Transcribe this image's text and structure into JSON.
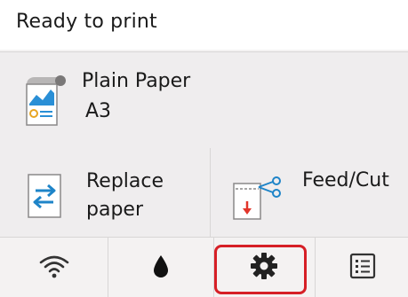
{
  "status": {
    "text": "Ready to print"
  },
  "paper": {
    "type": "Plain Paper",
    "size": "A3",
    "icon": "plain-paper-icon"
  },
  "actions": {
    "replace": {
      "line1": "Replace",
      "line2": "paper",
      "icon": "replace-paper-icon"
    },
    "feed": {
      "label": "Feed/Cut",
      "icon": "feed-cut-icon"
    }
  },
  "bottom_nav": {
    "items": [
      {
        "name": "wifi",
        "icon": "wifi-icon"
      },
      {
        "name": "ink",
        "icon": "ink-drop-icon"
      },
      {
        "name": "settings",
        "icon": "gear-icon",
        "highlighted": true
      },
      {
        "name": "menu",
        "icon": "list-icon"
      }
    ]
  },
  "colors": {
    "highlight": "#d61f26",
    "accent_blue": "#1e84c8",
    "accent_red": "#e2352a"
  }
}
